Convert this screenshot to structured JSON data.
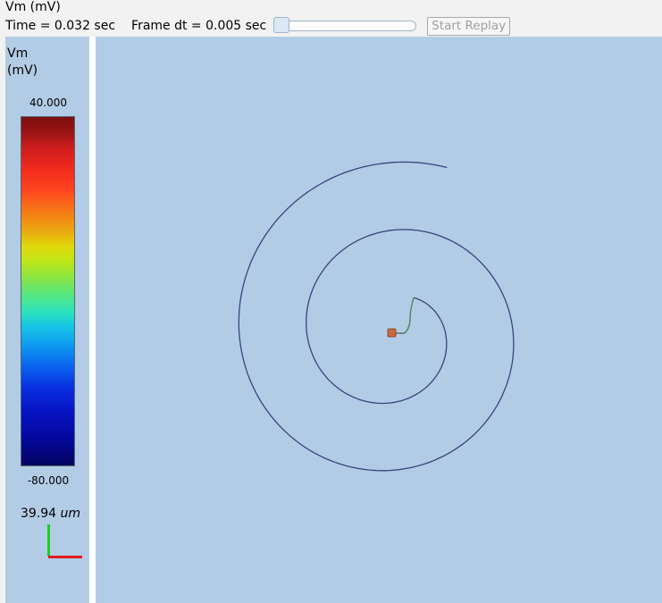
{
  "header": {
    "title": "Vm (mV)",
    "time_label": "Time = 0.032 sec",
    "frame_dt_label": "Frame dt = 0.005 sec",
    "replay_button_label": "Start Replay",
    "slider_value": 0.0
  },
  "colorbar": {
    "label": "Vm\n(mV)",
    "label_line1": "Vm",
    "label_line2": "(mV)",
    "max_label": "40.000",
    "min_label": "-80.000"
  },
  "scale_bar": {
    "value": "39.94",
    "unit": "um"
  },
  "colors": {
    "background": "#b3cce5",
    "neuron_stroke": "#34467a",
    "soma_fill": "#c86a40"
  }
}
